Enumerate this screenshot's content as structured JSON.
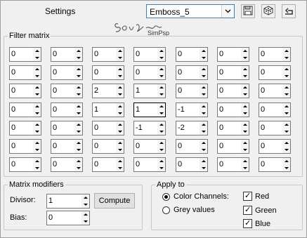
{
  "header": {
    "title": "Settings",
    "preset_value": "Emboss_5",
    "logo_text": "Sonickleam",
    "logo_subtext": "SimPsp"
  },
  "filter_matrix": {
    "label": "Filter matrix",
    "rows": [
      [
        "0",
        "0",
        "0",
        "0",
        "0",
        "0",
        "0"
      ],
      [
        "0",
        "0",
        "0",
        "0",
        "0",
        "0",
        "0"
      ],
      [
        "0",
        "0",
        "2",
        "1",
        "0",
        "0",
        "0"
      ],
      [
        "0",
        "0",
        "1",
        "1",
        "-1",
        "0",
        "0"
      ],
      [
        "0",
        "0",
        "0",
        "-1",
        "-2",
        "0",
        "0"
      ],
      [
        "0",
        "0",
        "0",
        "0",
        "0",
        "0",
        "0"
      ],
      [
        "0",
        "0",
        "0",
        "0",
        "0",
        "0",
        "0"
      ]
    ]
  },
  "matrix_modifiers": {
    "label": "Matrix modifiers",
    "divisor_label": "Divisor:",
    "divisor_value": "1",
    "bias_label": "Bias:",
    "bias_value": "0",
    "compute_label": "Compute"
  },
  "apply_to": {
    "label": "Apply to",
    "color_channels_label": "Color Channels:",
    "grey_values_label": "Grey values",
    "red_label": "Red",
    "green_label": "Green",
    "blue_label": "Blue"
  },
  "icons": [
    "save-icon",
    "randomize-icon",
    "reset-icon",
    "chevron-down-icon"
  ]
}
